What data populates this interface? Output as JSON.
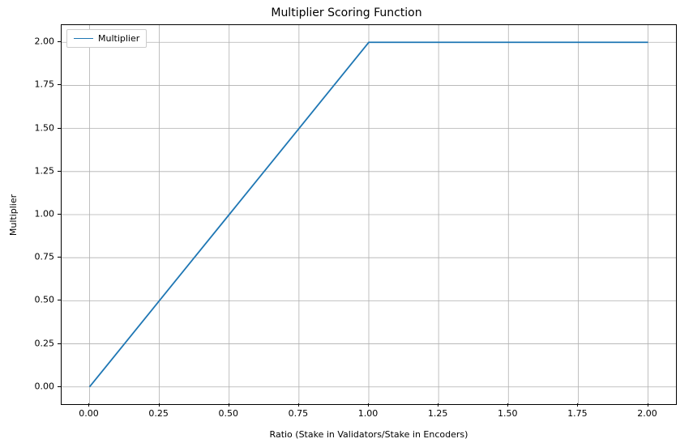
{
  "chart_data": {
    "type": "line",
    "title": "Multiplier Scoring Function",
    "xlabel": "Ratio (Stake in Validators/Stake in Encoders)",
    "ylabel": "Multiplier",
    "xlim": [
      -0.1,
      2.1
    ],
    "ylim": [
      -0.1,
      2.1
    ],
    "xticks": [
      0.0,
      0.25,
      0.5,
      0.75,
      1.0,
      1.25,
      1.5,
      1.75,
      2.0
    ],
    "yticks": [
      0.0,
      0.25,
      0.5,
      0.75,
      1.0,
      1.25,
      1.5,
      1.75,
      2.0
    ],
    "xtick_labels": [
      "0.00",
      "0.25",
      "0.50",
      "0.75",
      "1.00",
      "1.25",
      "1.50",
      "1.75",
      "2.00"
    ],
    "ytick_labels": [
      "0.00",
      "0.25",
      "0.50",
      "0.75",
      "1.00",
      "1.25",
      "1.50",
      "1.75",
      "2.00"
    ],
    "grid": true,
    "legend_position": "upper left",
    "series": [
      {
        "name": "Multiplier",
        "color": "#1f77b4",
        "x": [
          0.0,
          0.25,
          0.5,
          0.75,
          1.0,
          1.25,
          1.5,
          1.75,
          2.0
        ],
        "y": [
          0.0,
          0.5,
          1.0,
          1.5,
          2.0,
          2.0,
          2.0,
          2.0,
          2.0
        ]
      }
    ]
  }
}
